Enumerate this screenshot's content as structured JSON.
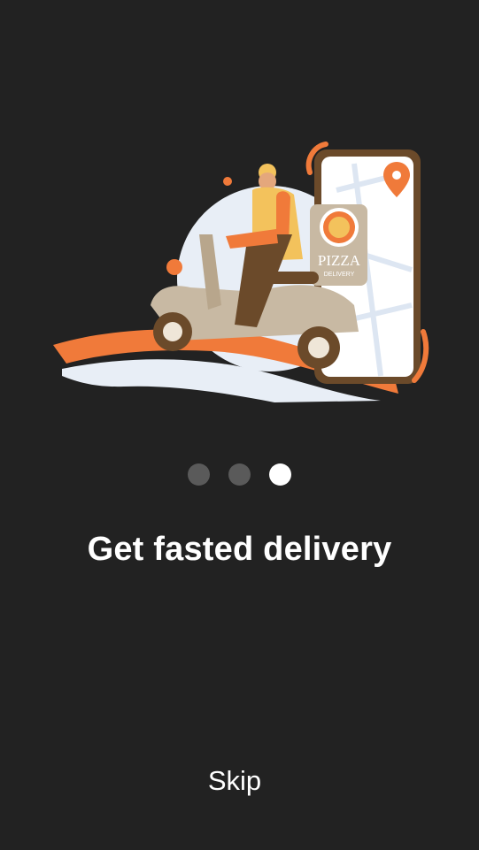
{
  "onboarding": {
    "illustration_icon": "pizza-delivery-scooter-illustration",
    "brand_box_text_top": "PIZZA",
    "brand_box_text_bottom": "DELIVERY",
    "pages_total": 3,
    "current_page": 3,
    "headline": "Get fasted delivery",
    "skip_label": "Skip"
  },
  "colors": {
    "background": "#222222",
    "accent": "#f07a3a",
    "dot_inactive": "#5a5a5a",
    "dot_active": "#ffffff",
    "text": "#ffffff"
  }
}
